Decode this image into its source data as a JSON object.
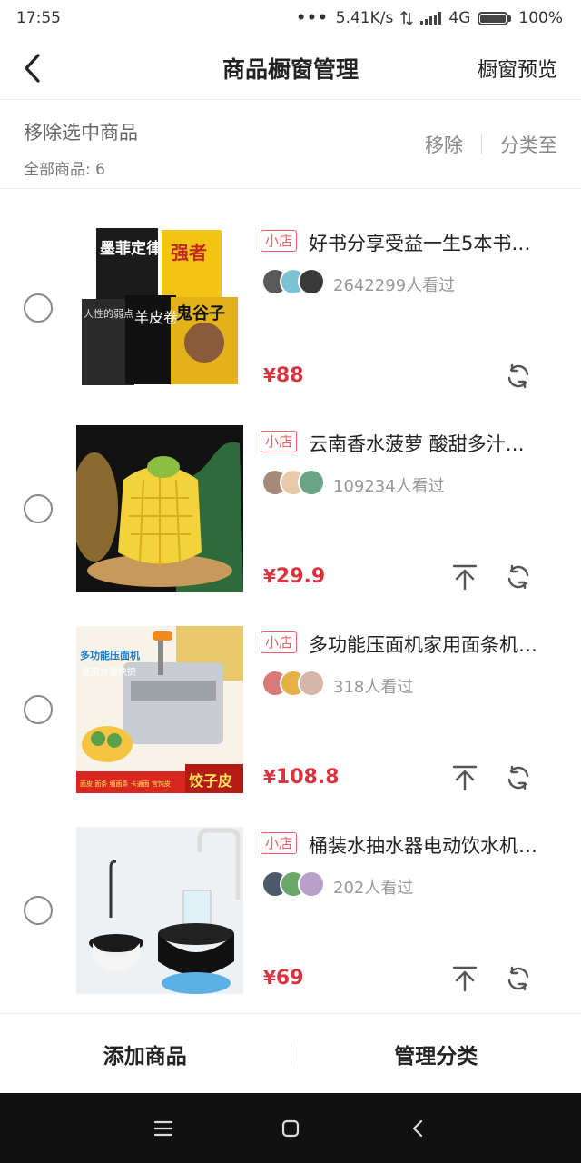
{
  "status_bar": {
    "time": "17:55",
    "dots": "•••",
    "speed": "5.41K/s",
    "network": "4G",
    "battery": "100%",
    "battery_level": 1.0
  },
  "nav": {
    "title": "商品橱窗管理",
    "preview_label": "橱窗预览"
  },
  "toolbar": {
    "remove_selected_label": "移除选中商品",
    "count_label": "全部商品: 6",
    "remove_label": "移除",
    "categorize_label": "分类至"
  },
  "products": [
    {
      "tag": "小店",
      "title": "好书分享受益一生5本书…",
      "viewers": "2642299人看过",
      "price_symbol": "¥",
      "price": "88",
      "has_pin": false,
      "thumb_kind": "books",
      "book_titles": [
        "墨菲定律",
        "强者",
        "羊皮卷",
        "鬼谷子",
        "人性的弱点"
      ]
    },
    {
      "tag": "小店",
      "title": "云南香水菠萝 酸甜多汁…",
      "viewers": "109234人看过",
      "price_symbol": "¥",
      "price": "29.9",
      "has_pin": true,
      "thumb_kind": "pineapple"
    },
    {
      "tag": "小店",
      "title": "多功能压面机家用面条机…",
      "viewers": "318人看过",
      "price_symbol": "¥",
      "price": "108.8",
      "has_pin": true,
      "thumb_kind": "pasta",
      "thumb_texts": [
        "多功能压面机",
        "使用方便快捷",
        "饺子皮",
        "面皮 面条 细面条 卡通面 宫饨皮"
      ]
    },
    {
      "tag": "小店",
      "title": "桶装水抽水器电动饮水机…",
      "viewers": "202人看过",
      "price_symbol": "¥",
      "price": "69",
      "has_pin": true,
      "thumb_kind": "pump"
    }
  ],
  "bottom": {
    "add_label": "添加商品",
    "manage_label": "管理分类"
  },
  "icons": {
    "back": "chevron-left-icon",
    "refresh": "refresh-icon",
    "pin": "pin-top-icon",
    "menu": "menu-icon",
    "home": "home-icon",
    "sys_back": "back-icon"
  },
  "colors": {
    "accent": "#d9333f",
    "tag": "#f25c66"
  }
}
